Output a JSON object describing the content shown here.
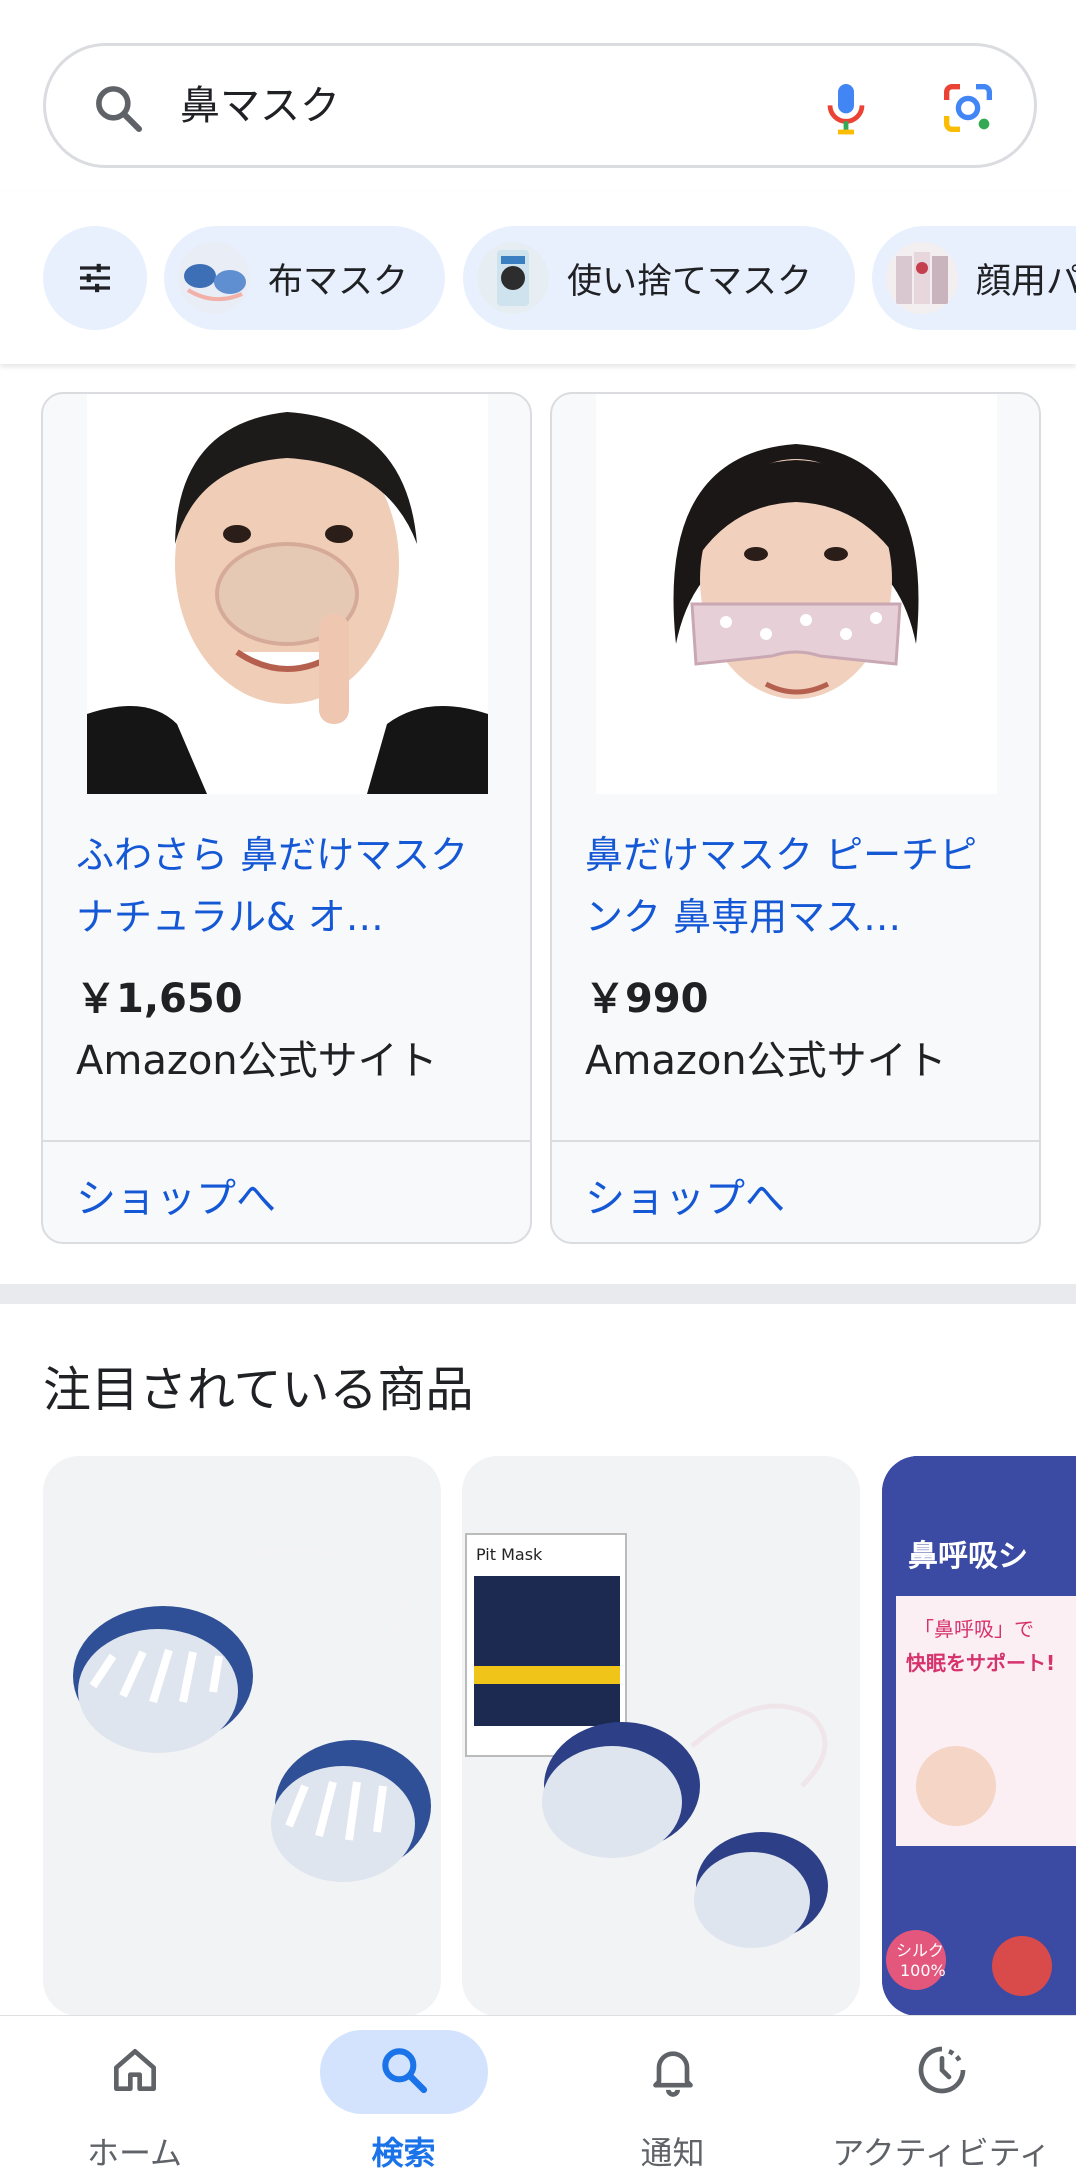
{
  "search": {
    "query": "鼻マスク"
  },
  "chips": [
    {
      "label": "布マスク"
    },
    {
      "label": "使い捨てマスク"
    },
    {
      "label": "顔用パ"
    }
  ],
  "products": [
    {
      "title": "ふわさら 鼻だけマスク ナチュラル& オ…",
      "price": "￥1,650",
      "seller": "Amazon公式サイト",
      "shop_label": "ショップへ"
    },
    {
      "title": "鼻だけマスク ピーチピンク 鼻専用マス…",
      "price": "￥990",
      "seller": "Amazon公式サイト",
      "shop_label": "ショップへ"
    }
  ],
  "featured": {
    "title": "注目されている商品",
    "tile2_brand": "Pit Mask",
    "tile3_text": [
      "鼻呼吸シ",
      "「鼻呼吸」で",
      "快眠をサポート!",
      "シルク",
      "100%"
    ]
  },
  "nav": [
    {
      "label": "ホーム",
      "icon": "home-icon"
    },
    {
      "label": "検索",
      "icon": "search-icon"
    },
    {
      "label": "通知",
      "icon": "bell-icon"
    },
    {
      "label": "アクティビティ",
      "icon": "activity-icon"
    }
  ],
  "colors": {
    "accent": "#1a73e8",
    "link": "#1558d6",
    "chip_bg": "#e8f0fe"
  }
}
